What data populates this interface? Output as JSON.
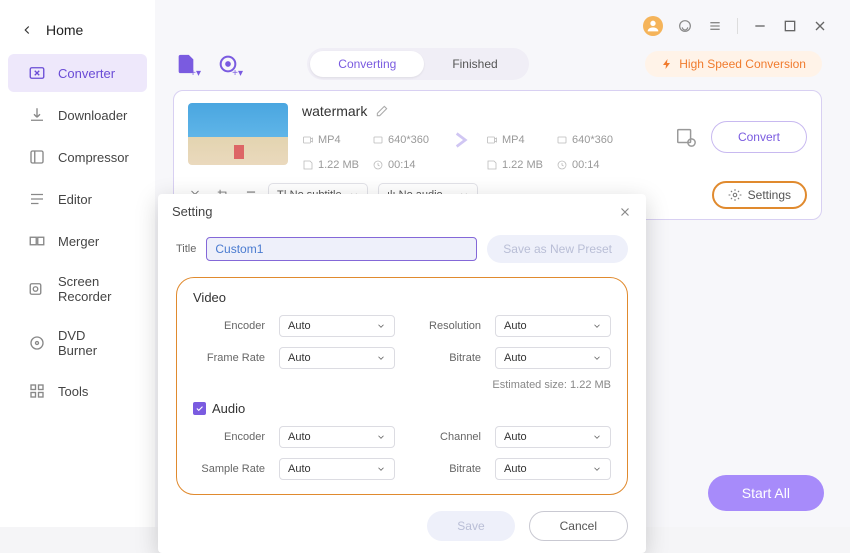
{
  "home": "Home",
  "sidebar": {
    "items": [
      "Converter",
      "Downloader",
      "Compressor",
      "Editor",
      "Merger",
      "Screen Recorder",
      "DVD Burner",
      "Tools"
    ]
  },
  "tabs": {
    "converting": "Converting",
    "finished": "Finished"
  },
  "hsc": "High Speed Conversion",
  "file": {
    "title": "watermark",
    "src": {
      "format": "MP4",
      "res": "640*360",
      "size": "1.22 MB",
      "dur": "00:14"
    },
    "dst": {
      "format": "MP4",
      "res": "640*360",
      "size": "1.22 MB",
      "dur": "00:14"
    },
    "subtitle": "No subtitle",
    "audio": "No audio"
  },
  "convert": "Convert",
  "settings": "Settings",
  "startall": "Start All",
  "modal": {
    "title": "Setting",
    "titleLabel": "Title",
    "titleVal": "Custom1",
    "savePreset": "Save as New Preset",
    "video": {
      "label": "Video",
      "encoder": {
        "l": "Encoder",
        "v": "Auto"
      },
      "resolution": {
        "l": "Resolution",
        "v": "Auto"
      },
      "framerate": {
        "l": "Frame Rate",
        "v": "Auto"
      },
      "bitrate": {
        "l": "Bitrate",
        "v": "Auto"
      },
      "est": "Estimated size: 1.22 MB"
    },
    "audio": {
      "label": "Audio",
      "encoder": {
        "l": "Encoder",
        "v": "Auto"
      },
      "channel": {
        "l": "Channel",
        "v": "Auto"
      },
      "samplerate": {
        "l": "Sample Rate",
        "v": "Auto"
      },
      "bitrate": {
        "l": "Bitrate",
        "v": "Auto"
      }
    },
    "save": "Save",
    "cancel": "Cancel"
  }
}
